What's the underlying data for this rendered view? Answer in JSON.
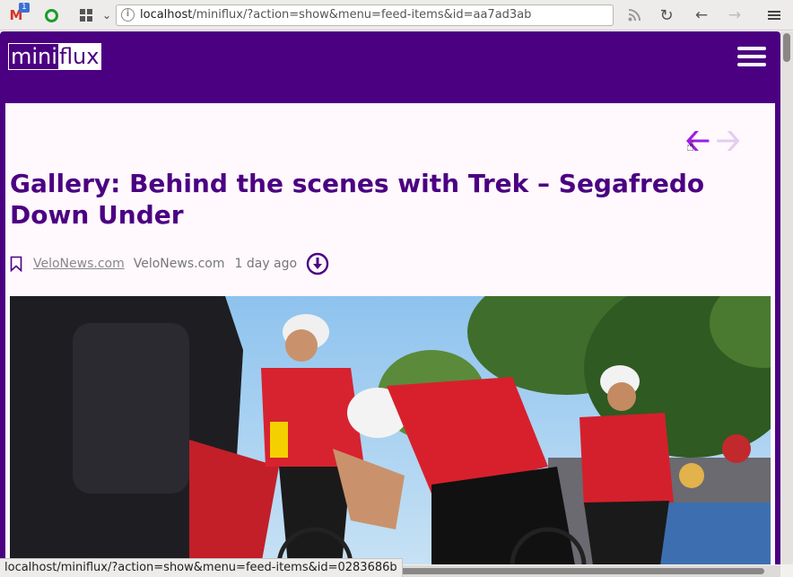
{
  "browser": {
    "gmail_badge": "1",
    "url_host": "localhost",
    "url_path": "/miniflux/?action=show&menu=feed-items&id=aa7ad3ab",
    "status_url": "localhost/miniflux/?action=show&menu=feed-items&id=0283686b"
  },
  "app": {
    "logo_part1": "mini",
    "logo_part2": "flux",
    "accent_color": "#4b0082"
  },
  "article": {
    "title": "Gallery: Behind the scenes with Trek – Segafredo Down Under",
    "site_link": "VeloNews.com",
    "feed_name": "VeloNews.com",
    "time_ago": "1 day ago"
  },
  "icons": {
    "bookmark": "bookmark-icon",
    "download": "download-icon",
    "prev": "previous-arrow-icon",
    "next": "next-arrow-icon"
  }
}
